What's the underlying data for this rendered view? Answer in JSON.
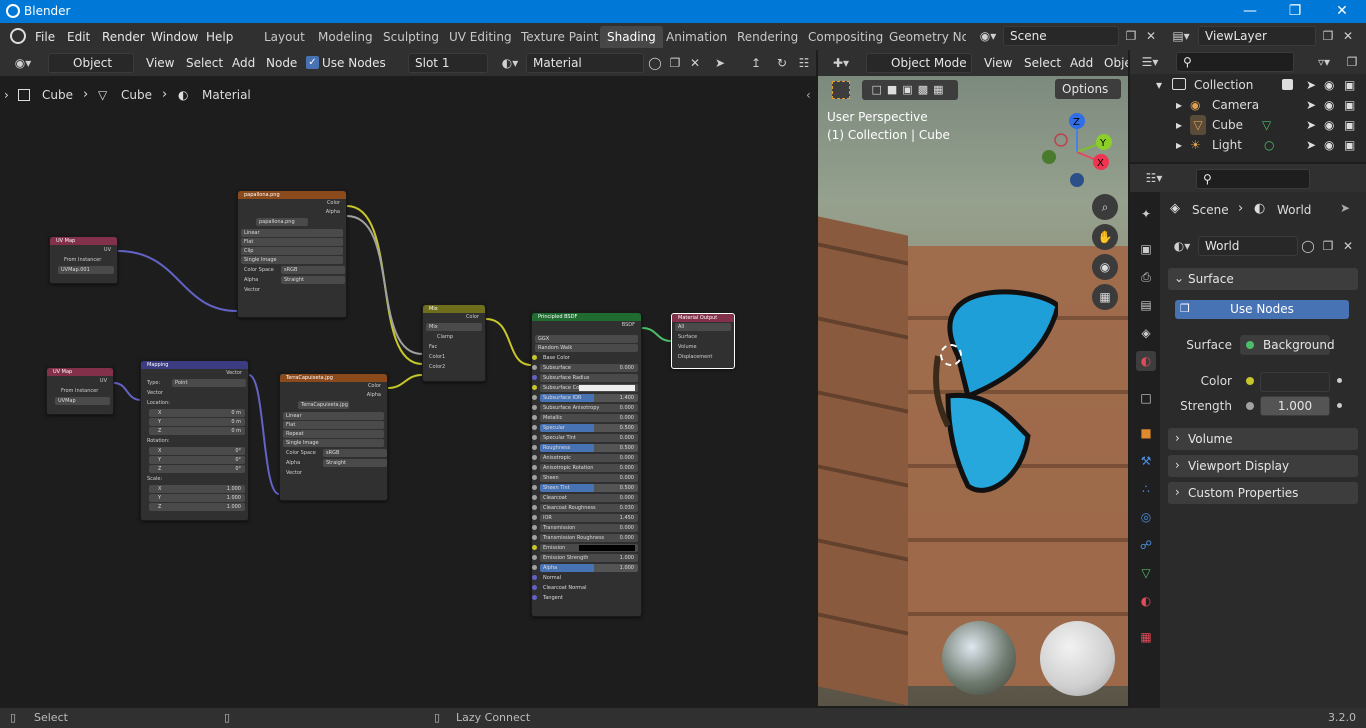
{
  "window": {
    "title": "Blender",
    "min": "—",
    "max": "❐",
    "close": "✕"
  },
  "menus": [
    "File",
    "Edit",
    "Render",
    "Window",
    "Help"
  ],
  "workspaces": [
    "Layout",
    "Modeling",
    "Sculpting",
    "UV Editing",
    "Texture Paint",
    "Shading",
    "Animation",
    "Rendering",
    "Compositing",
    "Geometry Noc"
  ],
  "active_workspace": "Shading",
  "scene": "Scene",
  "view_layer": "ViewLayer",
  "node_header": {
    "mode": "Object",
    "view": "View",
    "select": "Select",
    "add": "Add",
    "node": "Node",
    "use_nodes": "Use Nodes",
    "slot": "Slot 1",
    "material": "Material"
  },
  "breadcrumb": [
    "Cube",
    "Cube",
    "Material"
  ],
  "viewport": {
    "mode": "Object Mode",
    "view": "View",
    "select": "Select",
    "add": "Add",
    "object": "Obje",
    "options": "Options",
    "perspective": "User Perspective",
    "collection": "(1) Collection | Cube",
    "gizmo": {
      "z": "Z",
      "y": "Y",
      "x": "X"
    }
  },
  "outliner": {
    "collection": "Collection",
    "items": [
      "Camera",
      "Cube",
      "Light"
    ]
  },
  "properties": {
    "scene": "Scene",
    "world": "World",
    "world_field": "World",
    "surface_panel": "Surface",
    "use_nodes": "Use Nodes",
    "surface_label": "Surface",
    "surface_value": "Background",
    "color_label": "Color",
    "strength_label": "Strength",
    "strength_value": "1.000",
    "volume": "Volume",
    "viewport_display": "Viewport Display",
    "custom_properties": "Custom Properties"
  },
  "status": {
    "select": "Select",
    "lazy": "Lazy Connect",
    "version": "3.2.0"
  },
  "nodes": {
    "uvmap1": {
      "title": "UV Map",
      "out": "UV",
      "from_instancer": "From Instancer",
      "map": "UVMap.001"
    },
    "uvmap2": {
      "title": "UV Map",
      "out": "UV",
      "from_instancer": "From Instancer",
      "map": "UVMap"
    },
    "img1": {
      "title": "papallona.png",
      "out1": "Color",
      "out2": "Alpha",
      "file": "papallona.png",
      "interp": "Linear",
      "proj": "Flat",
      "ext": "Clip",
      "src": "Single Image",
      "cs_label": "Color Space",
      "cs": "sRGB",
      "alpha_label": "Alpha",
      "alpha": "Straight",
      "in": "Vector"
    },
    "img2": {
      "title": "TerraCapuixeta.jpg",
      "out1": "Color",
      "out2": "Alpha",
      "file": "TerraCapuixeta.jpg",
      "interp": "Linear",
      "proj": "Flat",
      "ext": "Repeat",
      "src": "Single Image",
      "cs_label": "Color Space",
      "cs": "sRGB",
      "alpha_label": "Alpha",
      "alpha": "Straight",
      "in": "Vector"
    },
    "mapping": {
      "title": "Mapping",
      "out": "Vector",
      "type_label": "Type:",
      "type": "Point",
      "in": "Vector",
      "loc": "Location:",
      "rot": "Rotation:",
      "scale": "Scale:",
      "loc_vals": [
        "0 m",
        "0 m",
        "0 m"
      ],
      "rot_vals": [
        "0°",
        "0°",
        "0°"
      ],
      "scale_vals": [
        "1.000",
        "1.000",
        "1.000"
      ],
      "axes": [
        "X",
        "Y",
        "Z"
      ]
    },
    "mix": {
      "title": "Mix",
      "out": "Color",
      "mode": "Mix",
      "clamp": "Clamp",
      "fac": "Fac",
      "c1": "Color1",
      "c2": "Color2"
    },
    "bsdf": {
      "title": "Principled BSDF",
      "out": "BSDF",
      "dist": "GGX",
      "sss": "Random Walk",
      "rows": [
        [
          "Base Color",
          ""
        ],
        [
          "Subsurface",
          "0.000"
        ],
        [
          "Subsurface Radius",
          ""
        ],
        [
          "Subsurface Color",
          ""
        ],
        [
          "Subsurface IOR",
          "1.400"
        ],
        [
          "Subsurface Anisotropy",
          "0.000"
        ],
        [
          "Metallic",
          "0.000"
        ],
        [
          "Specular",
          "0.500"
        ],
        [
          "Specular Tint",
          "0.000"
        ],
        [
          "Roughness",
          "0.500"
        ],
        [
          "Anisotropic",
          "0.000"
        ],
        [
          "Anisotropic Rotation",
          "0.000"
        ],
        [
          "Sheen",
          "0.000"
        ],
        [
          "Sheen Tint",
          "0.500"
        ],
        [
          "Clearcoat",
          "0.000"
        ],
        [
          "Clearcoat Roughness",
          "0.030"
        ],
        [
          "IOR",
          "1.450"
        ],
        [
          "Transmission",
          "0.000"
        ],
        [
          "Transmission Roughness",
          "0.000"
        ],
        [
          "Emission",
          ""
        ],
        [
          "Emission Strength",
          "1.000"
        ],
        [
          "Alpha",
          "1.000"
        ],
        [
          "Normal",
          ""
        ],
        [
          "Clearcoat Normal",
          ""
        ],
        [
          "Tangent",
          ""
        ]
      ]
    },
    "output": {
      "title": "Material Output",
      "target": "All",
      "in1": "Surface",
      "in2": "Volume",
      "in3": "Displacement"
    }
  }
}
